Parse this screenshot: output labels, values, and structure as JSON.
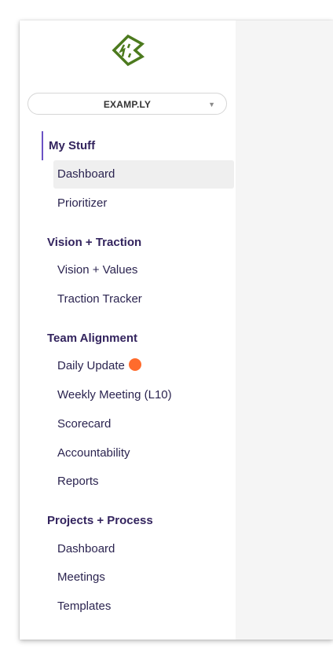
{
  "org_selector": {
    "label": "EXAMP.LY",
    "caret": "▼"
  },
  "logo": {
    "icon": "logo-icon",
    "color": "#4c7a1e"
  },
  "sections": {
    "my_stuff": {
      "title": "My Stuff",
      "items": [
        "Dashboard",
        "Prioritizer"
      ],
      "active_item": "Dashboard"
    },
    "vision_traction": {
      "title": "Vision + Traction",
      "items": [
        "Vision + Values",
        "Traction Tracker"
      ]
    },
    "team_alignment": {
      "title": "Team Alignment",
      "items": [
        "Daily Update",
        "Weekly Meeting (L10)",
        "Scorecard",
        "Accountability",
        "Reports"
      ],
      "badge_color": "#ff6b2c"
    },
    "projects_process": {
      "title": "Projects + Process",
      "items": [
        "Dashboard",
        "Meetings",
        "Templates"
      ]
    }
  },
  "colors": {
    "accent": "#6b52c4",
    "header_text": "#33245e",
    "item_text": "#2b2450",
    "active_bg": "#efefef"
  }
}
